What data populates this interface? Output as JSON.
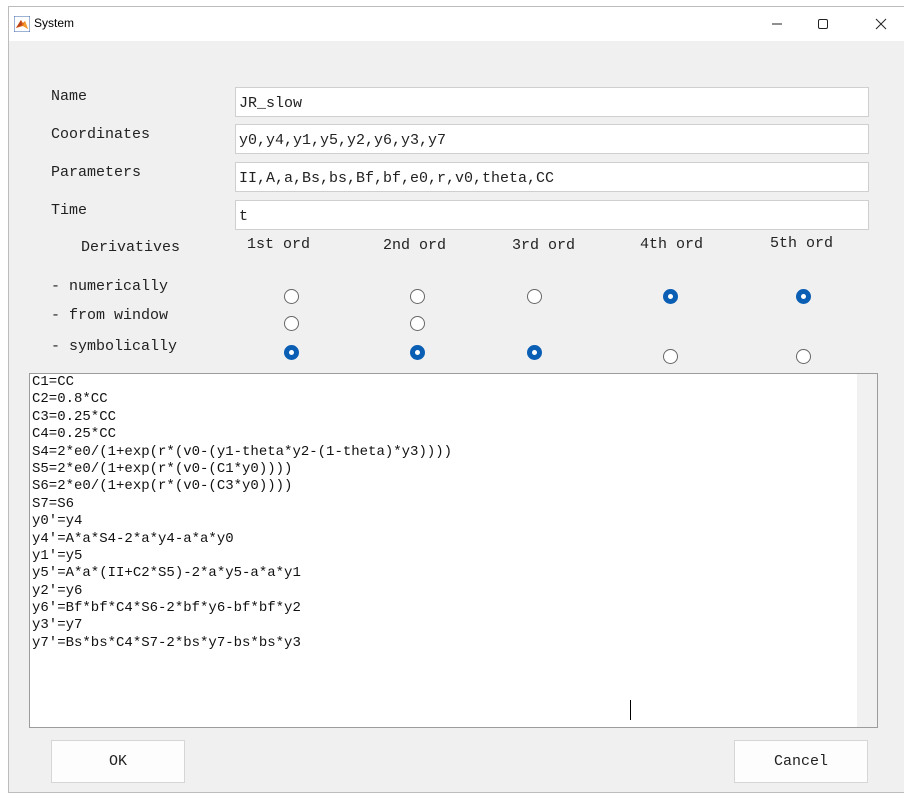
{
  "window": {
    "title": "System",
    "app_icon": "matlab-logo-icon",
    "controls": {
      "minimize": "minimize-icon",
      "maximize": "maximize-icon",
      "close": "close-icon"
    }
  },
  "form": {
    "name_label": "Name",
    "name_value": "JR_slow",
    "coordinates_label": "Coordinates",
    "coordinates_value": "y0,y4,y1,y5,y2,y6,y3,y7",
    "parameters_label": "Parameters",
    "parameters_value": "II,A,a,Bs,bs,Bf,bf,e0,r,v0,theta,CC",
    "time_label": "Time",
    "time_value": "t"
  },
  "derivatives": {
    "heading": "Derivatives",
    "orders": [
      "1st ord",
      "2nd ord",
      "3rd ord",
      "4th ord",
      "5th ord"
    ],
    "methods": [
      {
        "label": "- numerically",
        "selected": [
          false,
          false,
          false,
          true,
          true
        ],
        "present": [
          true,
          true,
          true,
          true,
          true
        ]
      },
      {
        "label": "- from window",
        "selected": [
          false,
          false,
          false,
          false,
          false
        ],
        "present": [
          true,
          true,
          false,
          false,
          false
        ]
      },
      {
        "label": "- symbolically",
        "selected": [
          true,
          true,
          true,
          false,
          false
        ],
        "present": [
          true,
          true,
          true,
          true,
          true
        ]
      }
    ]
  },
  "equations": [
    "C1=CC",
    "C2=0.8*CC",
    "C3=0.25*CC",
    "C4=0.25*CC",
    "S4=2*e0/(1+exp(r*(v0-(y1-theta*y2-(1-theta)*y3))))",
    "S5=2*e0/(1+exp(r*(v0-(C1*y0))))",
    "S6=2*e0/(1+exp(r*(v0-(C3*y0))))",
    "S7=S6",
    "y0'=y4",
    "y4'=A*a*S4-2*a*y4-a*a*y0",
    "y1'=y5",
    "y5'=A*a*(II+C2*S5)-2*a*y5-a*a*y1",
    "y2'=y6",
    "y6'=Bf*bf*C4*S6-2*bf*y6-bf*bf*y2",
    "y3'=y7",
    "y7'=Bs*bs*C4*S7-2*bs*y7-bs*bs*y3"
  ],
  "buttons": {
    "ok": "OK",
    "cancel": "Cancel"
  },
  "colors": {
    "radio_selected": "#0a5fb4",
    "window_bg": "#f0f0f0"
  }
}
